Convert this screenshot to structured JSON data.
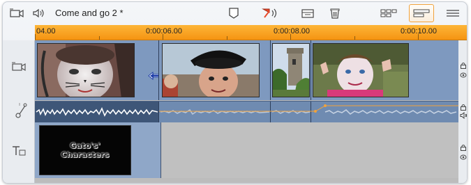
{
  "toolbar": {
    "project_title": "Come and go 2 *",
    "icons": [
      "video-track-icon",
      "speaker-wave-icon",
      "marker-icon",
      "razor-cut-icon",
      "clip-properties-icon",
      "trash-icon",
      "storyboard-view-icon",
      "timeline-view-icon",
      "text-view-icon"
    ]
  },
  "ruler": {
    "labels": [
      "04.00",
      "0:00:06.00",
      "0:00:08.00",
      "0:00:10.00"
    ]
  },
  "title_clip": {
    "line1": "Gato's'",
    "line2": "Characters"
  },
  "colors": {
    "ruler": "#f9a424",
    "track": "#6b87ad",
    "accent": "#f0a23c",
    "trim_arrow": "#1f3fa8"
  }
}
